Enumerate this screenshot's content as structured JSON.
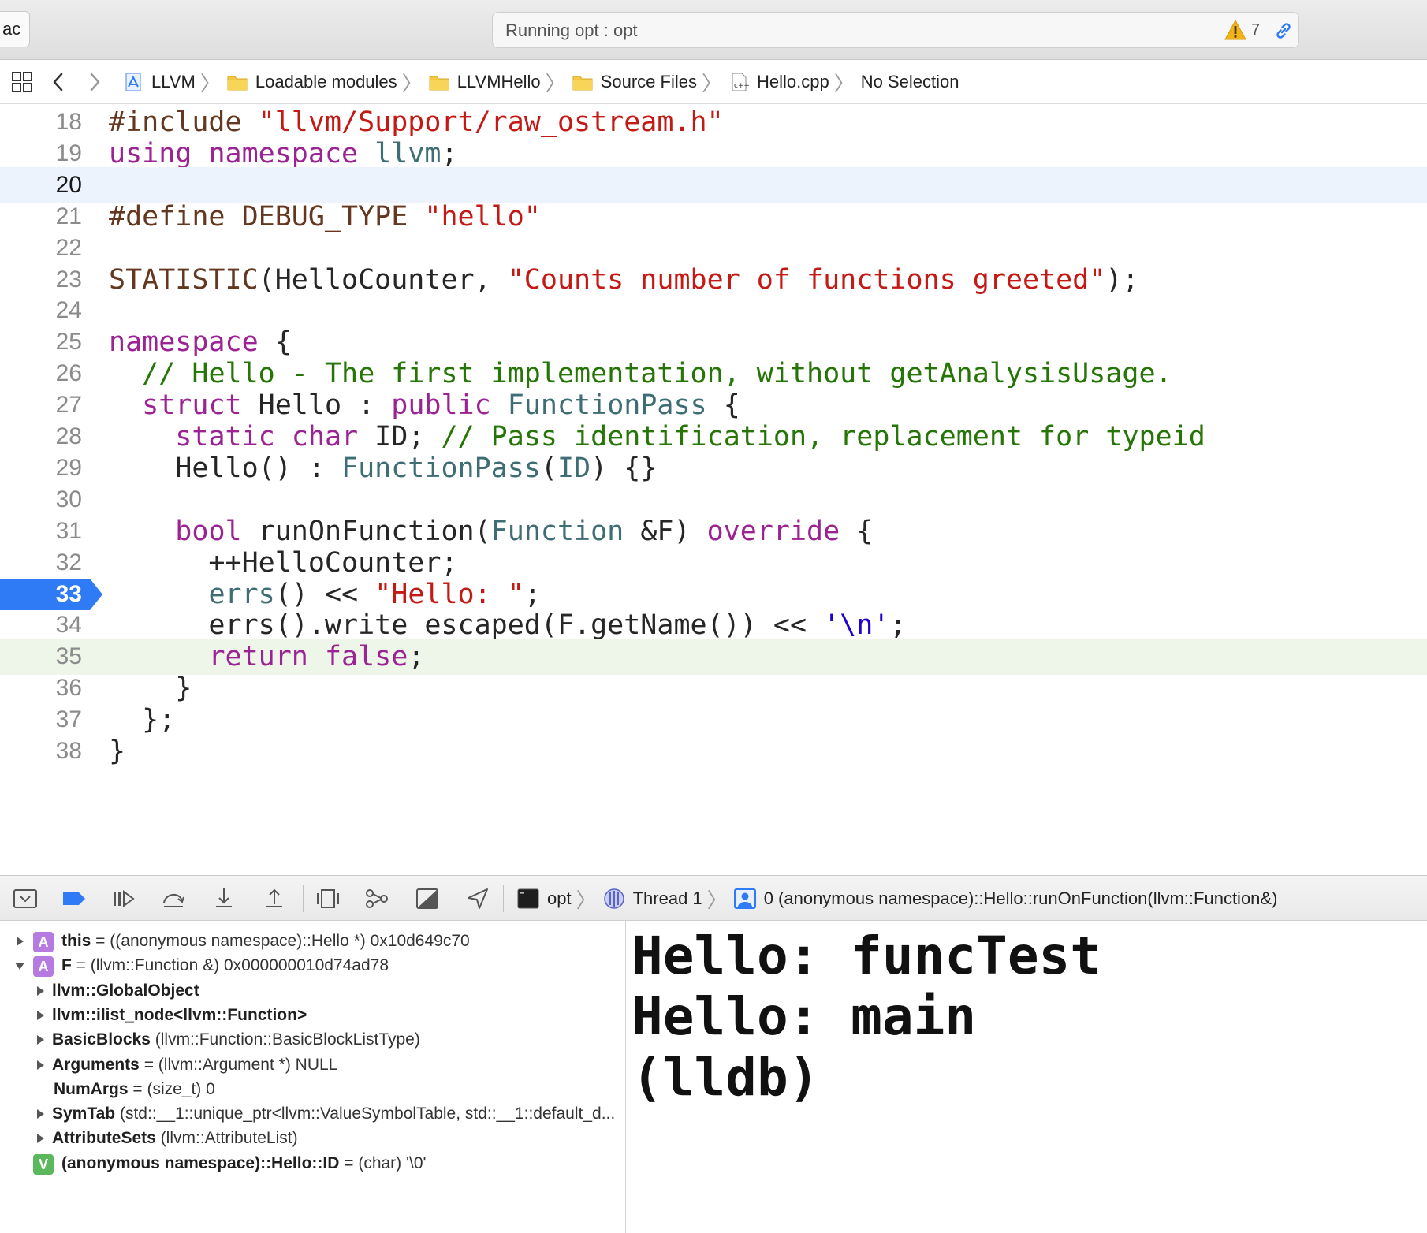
{
  "toolbar": {
    "scheme_label": "ac",
    "activity_text": "Running opt : opt",
    "warning_count": "7",
    "warning_color": "#f2b21a",
    "accent_color": "#2f7bf5"
  },
  "jumpbar": {
    "breadcrumbs": [
      {
        "label": "LLVM",
        "icon": "xcode-project-icon"
      },
      {
        "label": "Loadable modules",
        "icon": "folder-icon"
      },
      {
        "label": "LLVMHello",
        "icon": "folder-icon"
      },
      {
        "label": "Source Files",
        "icon": "folder-icon"
      },
      {
        "label": "Hello.cpp",
        "icon": "cpp-file-icon"
      },
      {
        "label": "No Selection",
        "icon": ""
      }
    ]
  },
  "editor": {
    "current_line": 20,
    "breakpoint_line": 33,
    "pc_line": 35,
    "lines": [
      {
        "n": "18",
        "tokens": [
          [
            "pre",
            "#include "
          ],
          [
            "str",
            "\"llvm/Support/raw_ostream.h\""
          ]
        ]
      },
      {
        "n": "19",
        "tokens": [
          [
            "kw",
            "using"
          ],
          [
            "plain",
            " "
          ],
          [
            "kw",
            "namespace"
          ],
          [
            "plain",
            " "
          ],
          [
            "type",
            "llvm"
          ],
          [
            "plain",
            ";"
          ]
        ]
      },
      {
        "n": "20",
        "tokens": []
      },
      {
        "n": "21",
        "tokens": [
          [
            "pre",
            "#define DEBUG_TYPE "
          ],
          [
            "str",
            "\"hello\""
          ]
        ]
      },
      {
        "n": "22",
        "tokens": []
      },
      {
        "n": "23",
        "tokens": [
          [
            "macro",
            "STATISTIC"
          ],
          [
            "plain",
            "(HelloCounter, "
          ],
          [
            "str",
            "\"Counts number of functions greeted\""
          ],
          [
            "plain",
            ");"
          ]
        ]
      },
      {
        "n": "24",
        "tokens": []
      },
      {
        "n": "25",
        "tokens": [
          [
            "kw",
            "namespace"
          ],
          [
            "plain",
            " {"
          ]
        ]
      },
      {
        "n": "26",
        "tokens": [
          [
            "plain",
            "  "
          ],
          [
            "cmt",
            "// Hello - The first implementation, without getAnalysisUsage."
          ]
        ]
      },
      {
        "n": "27",
        "tokens": [
          [
            "plain",
            "  "
          ],
          [
            "kw",
            "struct"
          ],
          [
            "plain",
            " Hello : "
          ],
          [
            "kw",
            "public"
          ],
          [
            "plain",
            " "
          ],
          [
            "type",
            "FunctionPass"
          ],
          [
            "plain",
            " {"
          ]
        ]
      },
      {
        "n": "28",
        "tokens": [
          [
            "plain",
            "    "
          ],
          [
            "kw",
            "static"
          ],
          [
            "plain",
            " "
          ],
          [
            "kw",
            "char"
          ],
          [
            "plain",
            " ID; "
          ],
          [
            "cmt",
            "// Pass identification, replacement for typeid"
          ]
        ]
      },
      {
        "n": "29",
        "tokens": [
          [
            "plain",
            "    Hello() : "
          ],
          [
            "type",
            "FunctionPass"
          ],
          [
            "plain",
            "("
          ],
          [
            "type",
            "ID"
          ],
          [
            "plain",
            ") {}"
          ]
        ]
      },
      {
        "n": "30",
        "tokens": []
      },
      {
        "n": "31",
        "tokens": [
          [
            "plain",
            "    "
          ],
          [
            "kw",
            "bool"
          ],
          [
            "plain",
            " runOnFunction("
          ],
          [
            "type",
            "Function"
          ],
          [
            "plain",
            " &F) "
          ],
          [
            "kw",
            "override"
          ],
          [
            "plain",
            " {"
          ]
        ]
      },
      {
        "n": "32",
        "tokens": [
          [
            "plain",
            "      ++HelloCounter;"
          ]
        ]
      },
      {
        "n": "33",
        "tokens": [
          [
            "plain",
            "      "
          ],
          [
            "type",
            "errs"
          ],
          [
            "plain",
            "() << "
          ],
          [
            "str",
            "\"Hello: \""
          ],
          [
            "plain",
            ";"
          ]
        ]
      },
      {
        "n": "34",
        "tokens": [
          [
            "plain",
            "      errs().write_escaped(F.getName()) << "
          ],
          [
            "chr",
            "'\\n'"
          ],
          [
            "plain",
            ";"
          ]
        ]
      },
      {
        "n": "35",
        "tokens": [
          [
            "plain",
            "      "
          ],
          [
            "kw",
            "return"
          ],
          [
            "plain",
            " "
          ],
          [
            "kw",
            "false"
          ],
          [
            "plain",
            ";"
          ]
        ]
      },
      {
        "n": "36",
        "tokens": [
          [
            "plain",
            "    }"
          ]
        ]
      },
      {
        "n": "37",
        "tokens": [
          [
            "plain",
            "  };"
          ]
        ]
      },
      {
        "n": "38",
        "tokens": [
          [
            "plain",
            "}"
          ]
        ]
      }
    ]
  },
  "debugbar": {
    "process": "opt",
    "thread": "Thread 1",
    "frame": "0 (anonymous namespace)::Hello::runOnFunction(llvm::Function&)"
  },
  "variables": [
    {
      "indent": 0,
      "disclosure": "closed",
      "badge": "A",
      "name": "this",
      "rest": " = ((anonymous namespace)::Hello *) 0x10d649c70"
    },
    {
      "indent": 0,
      "disclosure": "open",
      "badge": "A",
      "name": "F",
      "rest": " = (llvm::Function &) 0x000000010d74ad78"
    },
    {
      "indent": 1,
      "disclosure": "closed",
      "badge": "",
      "name": "llvm::GlobalObject",
      "rest": ""
    },
    {
      "indent": 1,
      "disclosure": "closed",
      "badge": "",
      "name": "llvm::ilist_node<llvm::Function>",
      "rest": ""
    },
    {
      "indent": 1,
      "disclosure": "closed",
      "badge": "",
      "name": "BasicBlocks",
      "rest": " (llvm::Function::BasicBlockListType)"
    },
    {
      "indent": 1,
      "disclosure": "closed",
      "badge": "",
      "name": "Arguments",
      "rest": " = (llvm::Argument *) NULL"
    },
    {
      "indent": 1,
      "disclosure": "none",
      "badge": "",
      "name": "NumArgs",
      "rest": " = (size_t) 0"
    },
    {
      "indent": 1,
      "disclosure": "closed",
      "badge": "",
      "name": "SymTab",
      "rest": " (std::__1::unique_ptr<llvm::ValueSymbolTable, std::__1::default_d..."
    },
    {
      "indent": 1,
      "disclosure": "closed",
      "badge": "",
      "name": "AttributeSets",
      "rest": " (llvm::AttributeList)"
    },
    {
      "indent": 0,
      "disclosure": "none",
      "badge": "V",
      "name": "(anonymous namespace)::Hello::ID",
      "rest": " = (char) '\\0'"
    }
  ],
  "console": {
    "lines": [
      "Hello: funcTest",
      "Hello: main",
      "(lldb)"
    ]
  }
}
